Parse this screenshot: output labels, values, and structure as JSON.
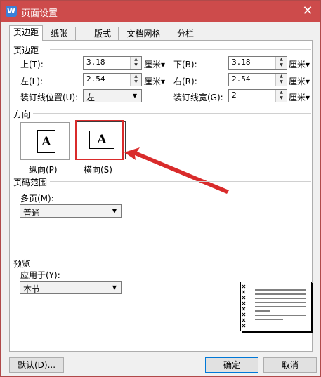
{
  "title": "页面设置",
  "app_icon": "W",
  "close_glyph": "✕",
  "tabs": [
    {
      "label": "页边距",
      "active": true
    },
    {
      "label": "纸张",
      "active": false
    },
    {
      "label": "版式",
      "active": false
    },
    {
      "label": "文档网格",
      "active": false
    },
    {
      "label": "分栏",
      "active": false
    }
  ],
  "margins": {
    "section": "页边距",
    "top_label": "上(T):",
    "top_value": "3.18",
    "bottom_label": "下(B):",
    "bottom_value": "3.18",
    "left_label": "左(L):",
    "left_value": "2.54",
    "right_label": "右(R):",
    "right_value": "2.54",
    "unit": "厘米▾",
    "gutter_pos_label": "装订线位置(U):",
    "gutter_pos_value": "左",
    "gutter_width_label": "装订线宽(G):",
    "gutter_width_value": "2"
  },
  "orientation": {
    "section": "方向",
    "portrait_label": "纵向(P)",
    "landscape_label": "横向(S)",
    "icon_letter": "A",
    "selected": "landscape"
  },
  "pages": {
    "section": "页码范围",
    "multi_label": "多页(M):",
    "multi_value": "普通"
  },
  "preview": {
    "section": "预览",
    "apply_label": "应用于(Y):",
    "apply_value": "本节"
  },
  "buttons": {
    "default": "默认(D)...",
    "ok": "确定",
    "cancel": "取消"
  },
  "annotation": {
    "color": "#d92b2b"
  }
}
